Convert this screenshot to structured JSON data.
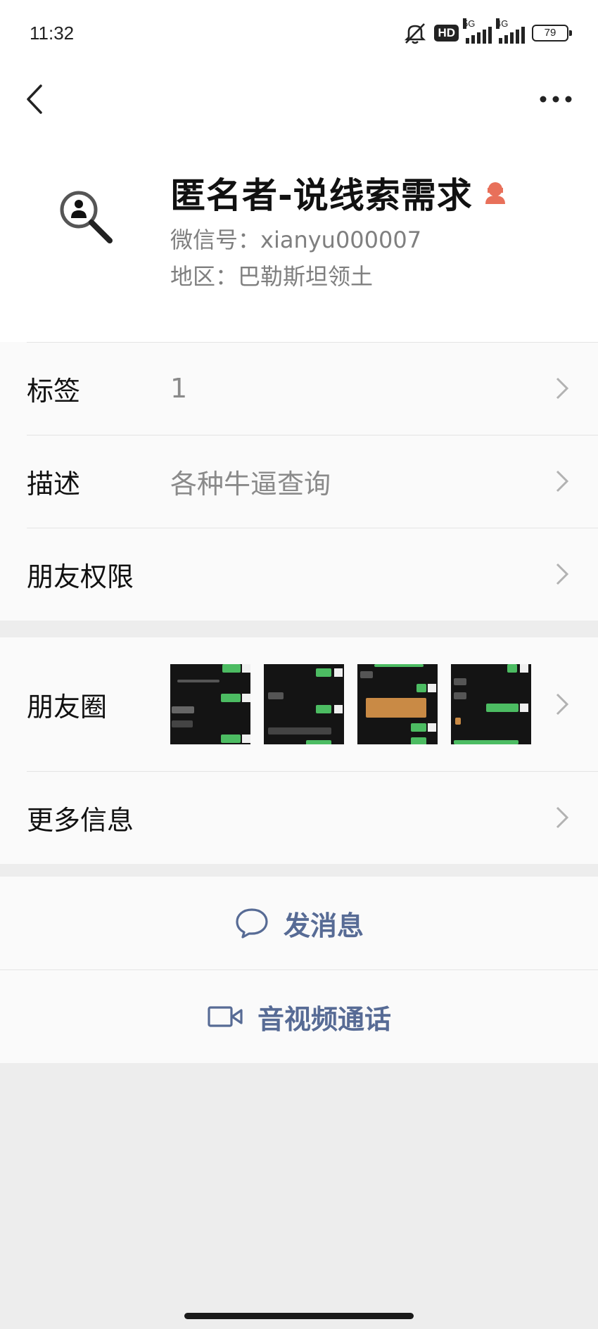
{
  "status_bar": {
    "time": "11:32",
    "hd_label": "HD",
    "net1": "5G",
    "net2": "4G",
    "battery": "79"
  },
  "icons": {
    "back": "chevron-left-icon",
    "more": "more-dots-icon",
    "avatar": "magnifier-person-icon",
    "gender": "female-icon",
    "chevron": "chevron-right-icon",
    "message": "chat-bubble-icon",
    "video": "video-camera-icon"
  },
  "profile": {
    "name": "匿名者-说线索需求",
    "wxid": "微信号：xianyu000007",
    "region": "地区：巴勒斯坦领土"
  },
  "rows": {
    "tags_label": "标签",
    "tags_value": "1",
    "desc_label": "描述",
    "desc_value": "各种牛逼查询",
    "permissions_label": "朋友权限",
    "moments_label": "朋友圈",
    "more_info_label": "更多信息"
  },
  "actions": {
    "send_message": "发消息",
    "av_call": "音视频通话"
  },
  "colors": {
    "accent": "#576b95",
    "gender_badge": "#e8705a",
    "chat_green": "#4cbc62"
  }
}
